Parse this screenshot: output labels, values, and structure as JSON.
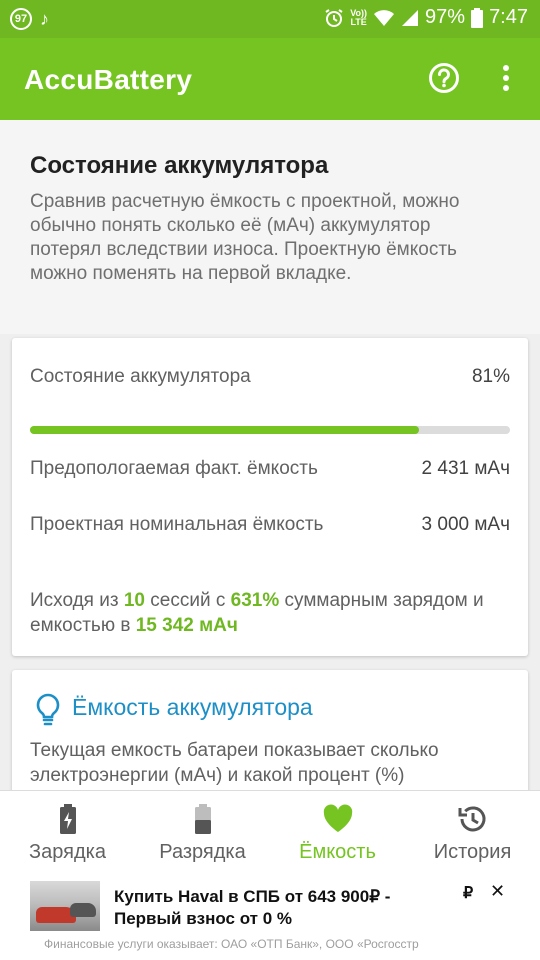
{
  "status_bar": {
    "badge": "97",
    "battery_percent": "97%",
    "time": "7:47",
    "volte_top": "Vo))",
    "volte_bottom": "LTE"
  },
  "app_bar": {
    "title": "AccuBattery",
    "help_icon": "help-circle-icon",
    "more_icon": "more-vertical-icon"
  },
  "intro": {
    "title": "Состояние аккумулятора",
    "text": "Сравнив расчетную ёмкость с проектной, можно обычно понять сколько её (мАч) аккумулятор потерял вследствии износа. Проектную ёмкость можно поменять на первой вкладке."
  },
  "health_card": {
    "health_label": "Состояние аккумулятора",
    "health_value": "81%",
    "health_fraction": 0.81,
    "estimated_label": "Предопологаемая факт. ёмкость",
    "estimated_value": "2 431 мАч",
    "design_label": "Проектная номинальная ёмкость",
    "design_value": "3 000 мАч",
    "summary": {
      "part1": "Исходя из ",
      "sessions": "10",
      "part2": " сессий с ",
      "percent": "631%",
      "part3": " суммарным зарядом и емкостью в ",
      "capacity": "15 342 мАч"
    }
  },
  "capacity_card": {
    "icon": "lightbulb-icon",
    "title": "Ёмкость аккумулятора",
    "text": "Текущая емкость батареи показывает сколько электроэнергии (мАч) и какой процент (%)"
  },
  "bottom_nav": {
    "items": [
      {
        "label": "Зарядка",
        "icon": "battery-charging-icon"
      },
      {
        "label": "Разрядка",
        "icon": "battery-discharging-icon"
      },
      {
        "label": "Ёмкость",
        "icon": "heart-icon"
      },
      {
        "label": "История",
        "icon": "history-icon"
      }
    ],
    "active_index": 2
  },
  "ad": {
    "title": "Купить Haval в СПБ от 643 900₽ - Первый взнос от 0 %",
    "currency_icon": "₽",
    "close_icon": "✕",
    "footer": "Финансовые услуги оказывает: ОАО «ОТП Банк», ООО «Росгосстр"
  },
  "colors": {
    "accent": "#75c421",
    "status_bar": "#6fb822",
    "link_blue": "#1d8fc7"
  }
}
